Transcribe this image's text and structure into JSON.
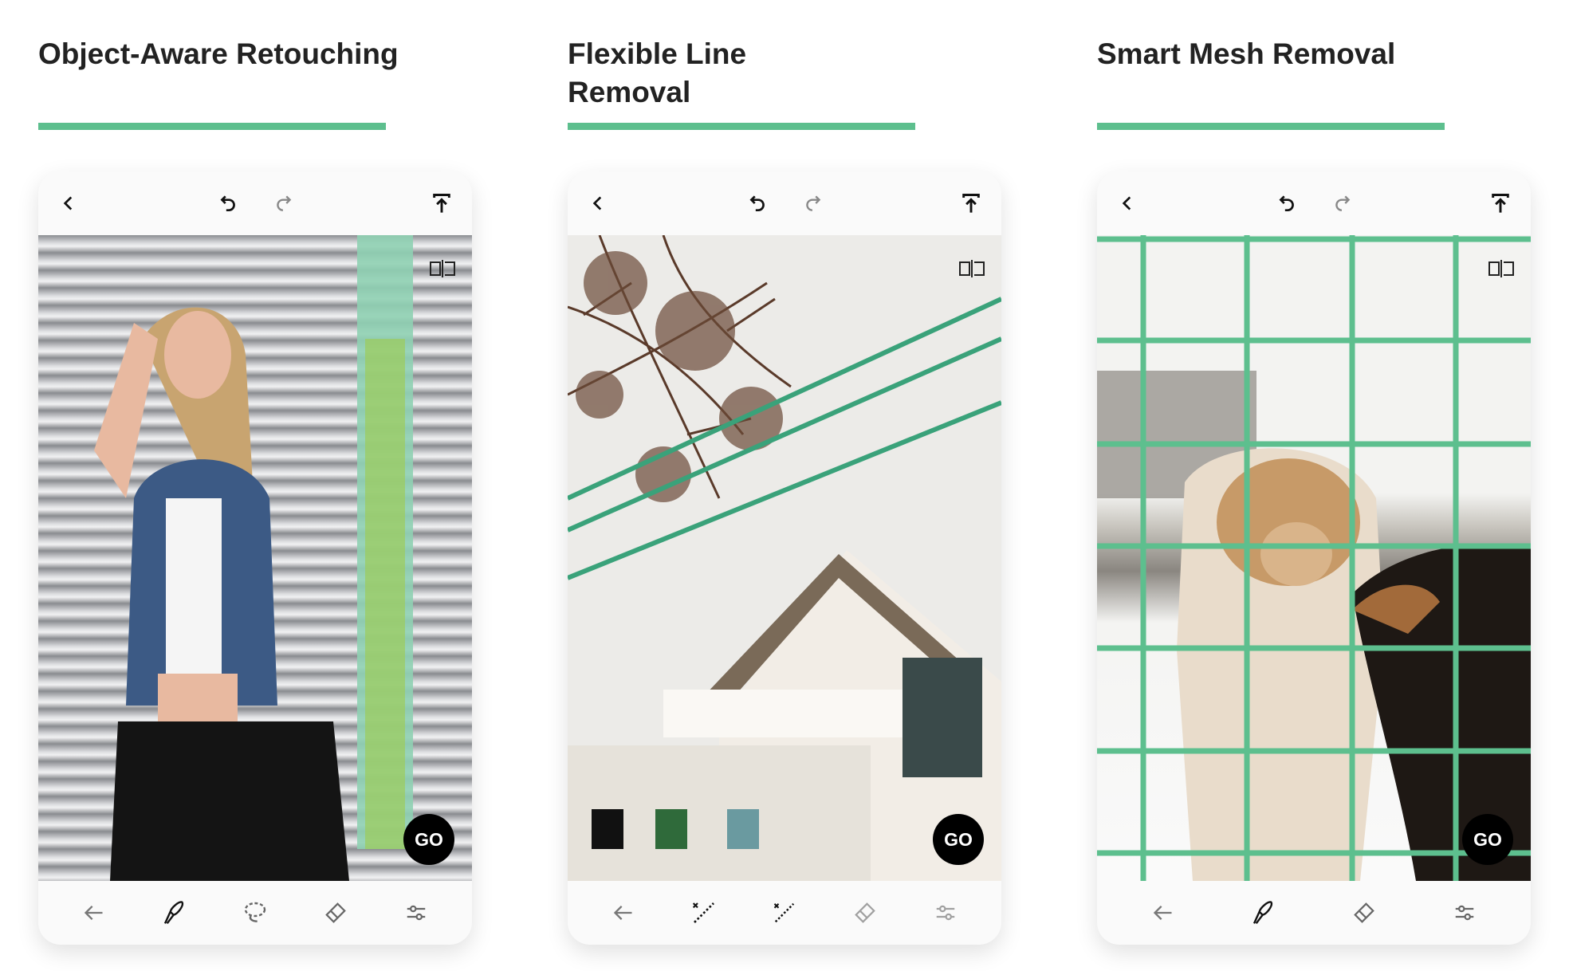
{
  "accent_color": "#5dbf8e",
  "panels": [
    {
      "title": "Object-Aware Retouching",
      "go_label": "GO",
      "top_icons": [
        "back-chevron-icon",
        "undo-icon",
        "redo-icon",
        "export-icon"
      ],
      "tools": [
        "back-arrow-icon",
        "object-brush-icon",
        "lasso-icon",
        "eraser-icon",
        "settings-sliders-icon"
      ]
    },
    {
      "title": "Flexible Line Removal",
      "go_label": "GO",
      "top_icons": [
        "back-chevron-icon",
        "undo-icon",
        "redo-icon",
        "export-icon"
      ],
      "tools": [
        "back-arrow-icon",
        "line-tool-icon",
        "segment-tool-icon",
        "eraser-icon",
        "settings-sliders-icon"
      ]
    },
    {
      "title": "Smart Mesh Removal",
      "go_label": "GO",
      "top_icons": [
        "back-chevron-icon",
        "undo-icon",
        "redo-icon",
        "export-icon"
      ],
      "tools": [
        "back-arrow-icon",
        "brush-icon",
        "eraser-icon",
        "settings-sliders-icon"
      ]
    }
  ]
}
